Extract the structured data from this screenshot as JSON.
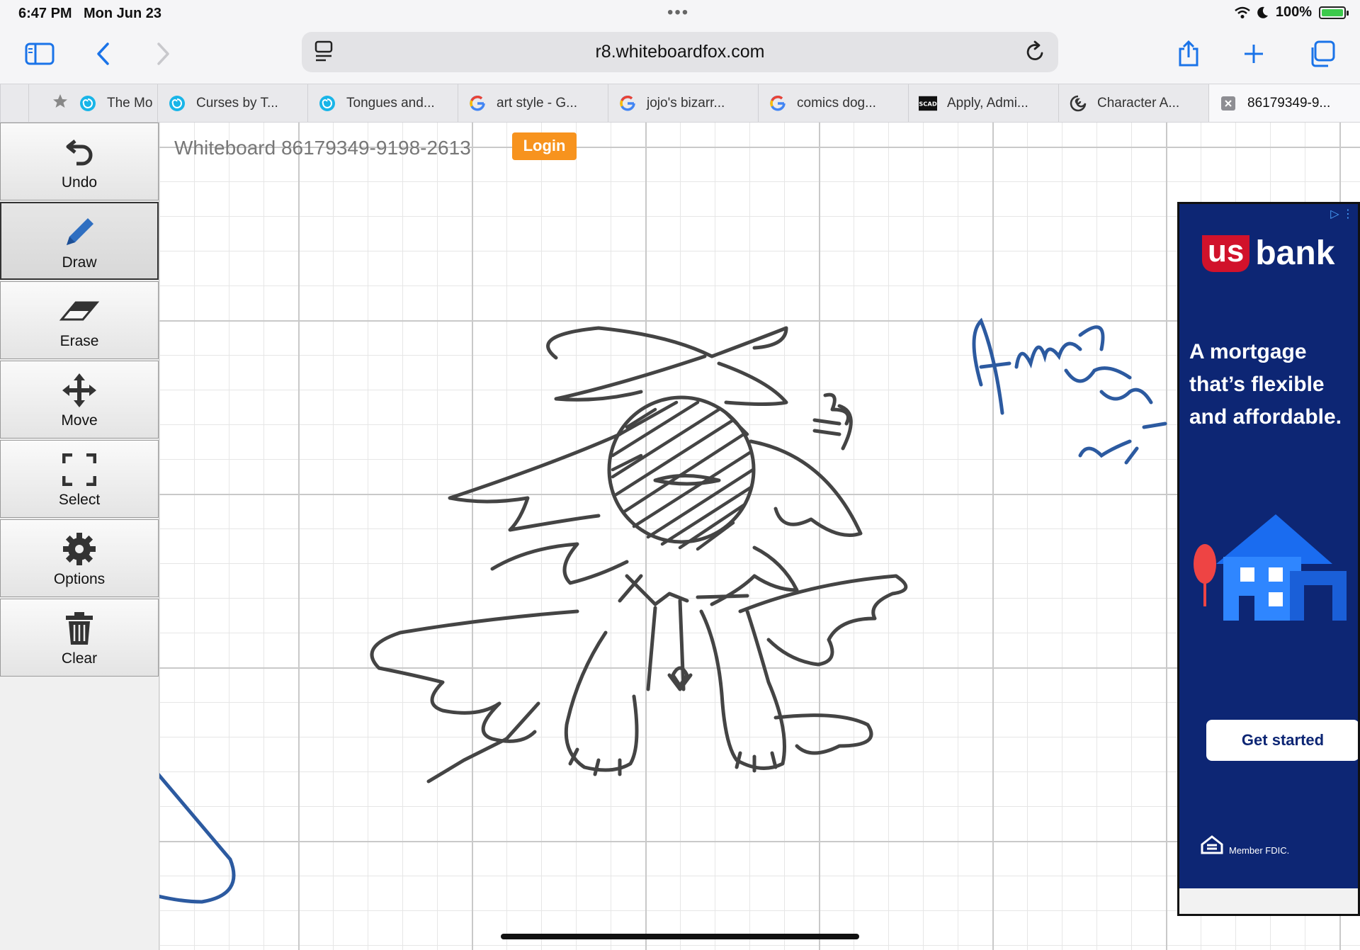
{
  "status": {
    "time": "6:47 PM",
    "date": "Mon Jun 23",
    "battery": "100%"
  },
  "browser": {
    "url": "r8.whiteboardfox.com"
  },
  "tabs": [
    {
      "label": "The Mo",
      "favicon": "blue-spiral-icon"
    },
    {
      "label": "Curses by T...",
      "favicon": "blue-spiral-icon"
    },
    {
      "label": "Tongues and...",
      "favicon": "blue-spiral-icon"
    },
    {
      "label": "art style - G...",
      "favicon": "google-icon"
    },
    {
      "label": "jojo's bizarr...",
      "favicon": "google-icon"
    },
    {
      "label": "comics dog...",
      "favicon": "google-icon"
    },
    {
      "label": "Apply, Admi...",
      "favicon": "scad-icon"
    },
    {
      "label": "Character A...",
      "favicon": "swirl-icon"
    },
    {
      "label": "86179349-9...",
      "favicon": "close-icon"
    }
  ],
  "tools": [
    {
      "label": "Undo",
      "icon": "undo-icon"
    },
    {
      "label": "Draw",
      "icon": "pencil-icon",
      "selected": true
    },
    {
      "label": "Erase",
      "icon": "eraser-icon"
    },
    {
      "label": "Move",
      "icon": "move-icon"
    },
    {
      "label": "Select",
      "icon": "select-icon"
    },
    {
      "label": "Options",
      "icon": "gear-icon"
    },
    {
      "label": "Clear",
      "icon": "trash-icon"
    }
  ],
  "whiteboard": {
    "title": "Whiteboard 86179349-9198-2613",
    "login_label": "Login"
  },
  "ad": {
    "brand_us": "us",
    "brand_bank": "bank",
    "headline": "A mortgage that’s flexible and affordable.",
    "cta": "Get started",
    "fdic": "Member FDIC.",
    "colors": {
      "background": "#0d2674",
      "accent": "#d1122b",
      "house": "#1a6cf0"
    }
  },
  "colors": {
    "login": "#f7931e",
    "ink_dark": "#444444",
    "ink_blue": "#2c5aa0",
    "browser_accent": "#1a73e8"
  }
}
